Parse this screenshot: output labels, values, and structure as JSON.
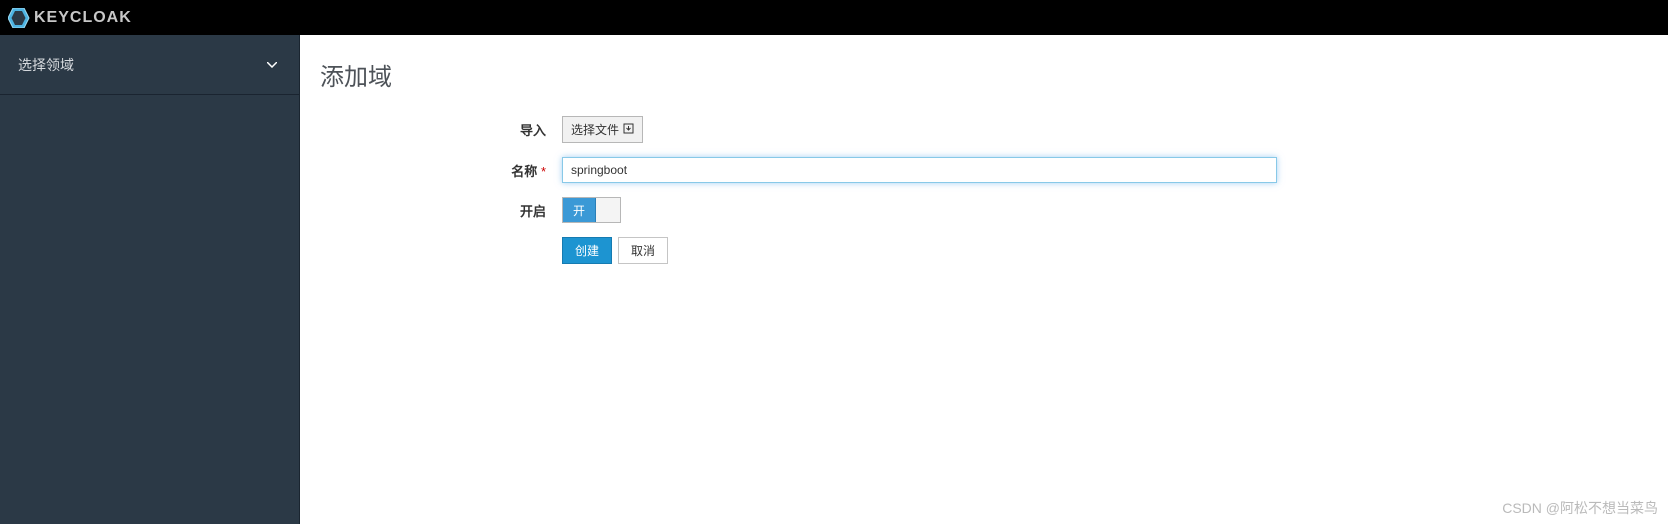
{
  "header": {
    "brand": "KEYCLOAK"
  },
  "sidebar": {
    "realm_selector_label": "选择领域"
  },
  "page": {
    "title": "添加域"
  },
  "form": {
    "import_label": "导入",
    "file_button": "选择文件",
    "name_label": "名称",
    "name_value": "springboot",
    "enable_label": "开启",
    "toggle_on": "开",
    "create_button": "创建",
    "cancel_button": "取消"
  },
  "watermark": "CSDN @阿松不想当菜鸟"
}
